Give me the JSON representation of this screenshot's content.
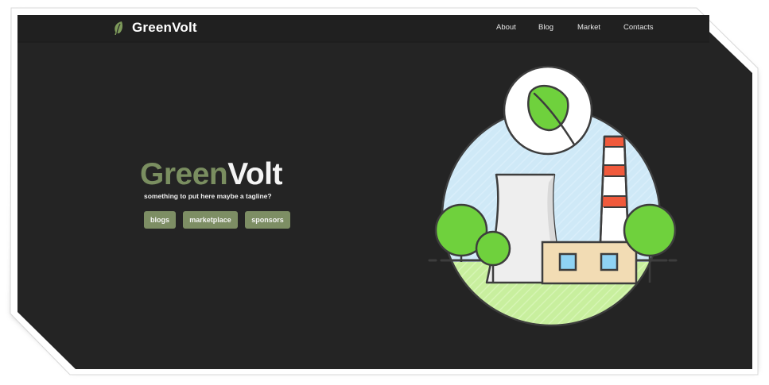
{
  "nav": {
    "brand": "GreenVolt",
    "links": [
      "About",
      "Blog",
      "Market",
      "Contacts"
    ]
  },
  "hero": {
    "title_part1": "Green",
    "title_part2": "Volt",
    "tagline": "something to put here maybe a tagline?",
    "buttons": [
      "blogs",
      "marketplace",
      "sponsors"
    ]
  },
  "colors": {
    "background": "#242424",
    "navbar": "#202020",
    "accent_green": "#7a8e60",
    "button_green": "#7d8e64",
    "text": "#f4f4f4"
  },
  "icons": {
    "brand": "leaf-icon",
    "illustration": "power-plant-illustration"
  }
}
